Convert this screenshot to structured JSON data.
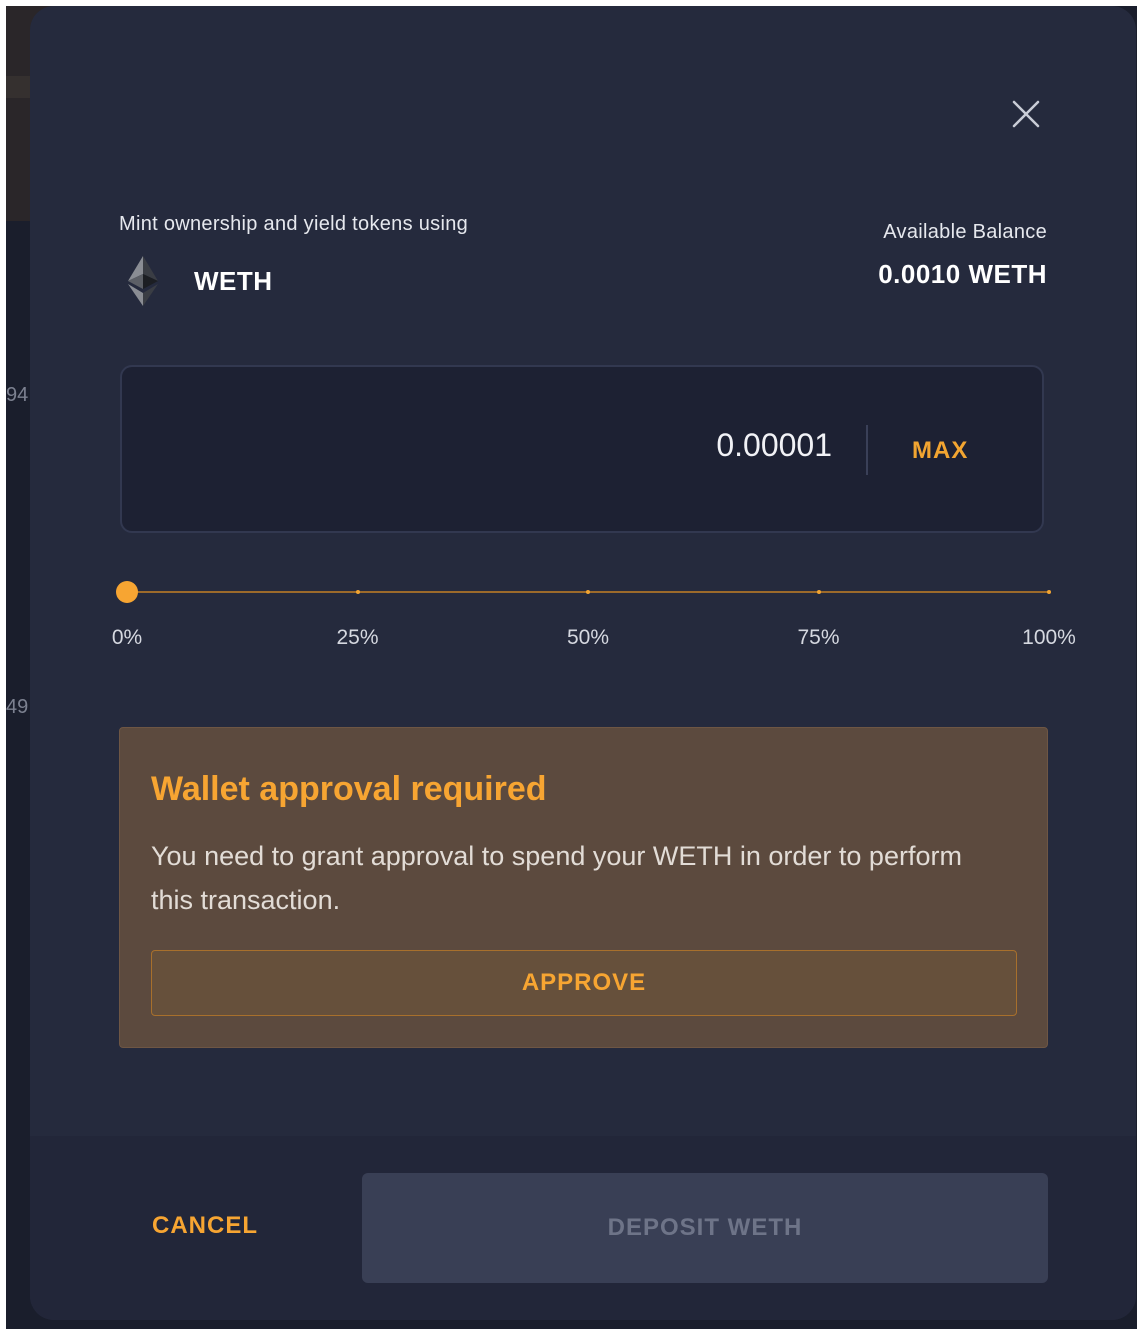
{
  "background": {
    "partial_numbers": [
      "94",
      "49"
    ]
  },
  "modal": {
    "intro_text": "Mint ownership and yield tokens using",
    "token": {
      "name": "WETH",
      "icon": "ethereum-icon"
    },
    "balance": {
      "label": "Available Balance",
      "value": "0.0010 WETH"
    },
    "amount": {
      "value": "0.00001",
      "max_label": "MAX"
    },
    "slider": {
      "value_percent": 0,
      "labels": [
        "0%",
        "25%",
        "50%",
        "75%",
        "100%"
      ]
    },
    "approval": {
      "title": "Wallet approval required",
      "text": "You need to grant approval to spend your WETH in order to perform this transaction.",
      "button_label": "APPROVE"
    },
    "footer": {
      "cancel_label": "CANCEL",
      "deposit_label": "DEPOSIT WETH"
    },
    "close_icon": "close-icon"
  },
  "colors": {
    "accent": "#f7a532",
    "modal_bg": "#252a3d",
    "approval_bg": "#5c4a3e"
  }
}
